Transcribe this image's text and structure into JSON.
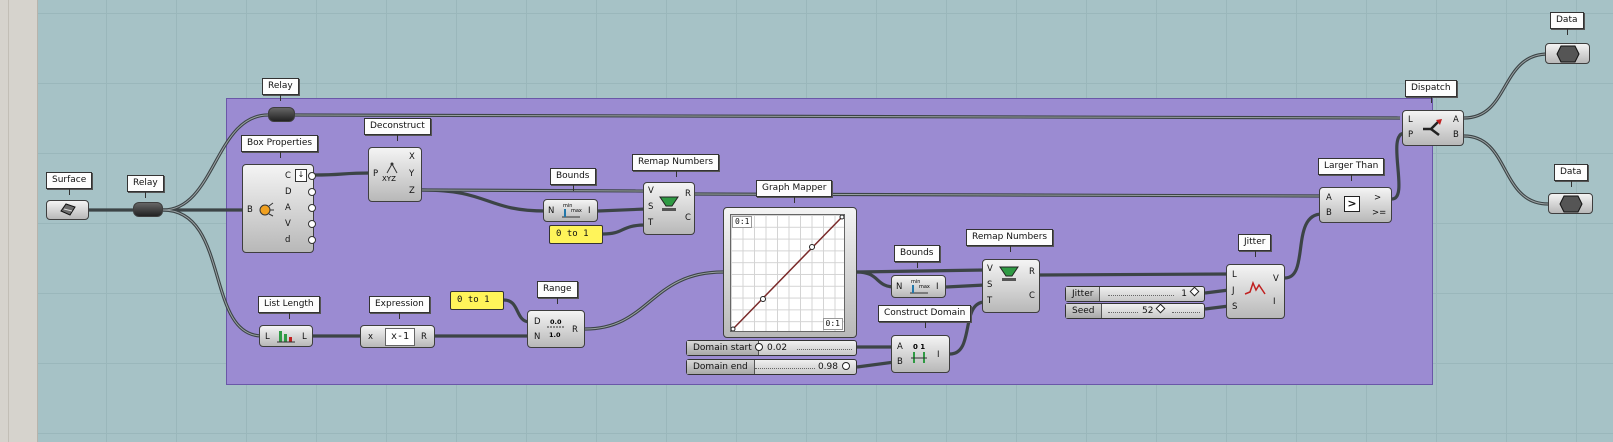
{
  "canvas": {
    "background": "#a6c2c6",
    "group_color": "#9b8bd2"
  },
  "labels": {
    "surface": "Surface",
    "relay_left": "Relay",
    "relay_top": "Relay",
    "box_properties": "Box Properties",
    "deconstruct": "Deconstruct",
    "bounds_1": "Bounds",
    "remap_1": "Remap Numbers",
    "graph_mapper": "Graph Mapper",
    "list_length": "List Length",
    "expression": "Expression",
    "range": "Range",
    "bounds_2": "Bounds",
    "remap_2": "Remap Numbers",
    "construct_domain": "Construct Domain",
    "jitter": "Jitter",
    "larger_than": "Larger Than",
    "dispatch": "Dispatch",
    "data_top": "Data",
    "data_bottom": "Data"
  },
  "ports": {
    "box_in": [
      "B"
    ],
    "box_out": [
      "C",
      "D",
      "A",
      "V",
      "d"
    ],
    "deconstruct_in": [
      "P"
    ],
    "deconstruct_out": [
      "X",
      "Y",
      "Z"
    ],
    "bounds_in": [
      "N"
    ],
    "bounds_out": [
      "I"
    ],
    "remap_in": [
      "V",
      "S",
      "T"
    ],
    "remap_out": [
      "R",
      "C"
    ],
    "list_in": [
      "L"
    ],
    "list_out": [
      "L"
    ],
    "expr_in": [
      "x"
    ],
    "expr_out": [
      "R"
    ],
    "range_in": [
      "D",
      "N"
    ],
    "range_out": [
      "R"
    ],
    "construct_in": [
      "A",
      "B"
    ],
    "construct_out": [
      "I"
    ],
    "jitter_in": [
      "L",
      "J",
      "S"
    ],
    "jitter_out": [
      "V",
      "I"
    ],
    "larger_in": [
      "A",
      "B"
    ],
    "larger_out": [
      ">",
      ">="
    ],
    "dispatch_in": [
      "L",
      "P"
    ],
    "dispatch_out": [
      "A",
      "B"
    ]
  },
  "expression": {
    "text": "x-1"
  },
  "panels": {
    "domain_1": "0 to 1",
    "domain_2": "0 to 1"
  },
  "graph_mapper": {
    "tag_top": "0:1",
    "tag_bottom": "0:1"
  },
  "sliders": {
    "domain_start": {
      "name": "Domain start",
      "value": "0.02"
    },
    "domain_end": {
      "name": "Domain end",
      "value": "0.98"
    },
    "jitter": {
      "name": "Jitter",
      "value": "1"
    },
    "seed": {
      "name": "Seed",
      "value": "52"
    }
  },
  "icons": {
    "surface": "surface-icon",
    "box": "box-properties-icon",
    "deconstruct": "xyz-deconstruct-icon",
    "bounds": "bounds-icon",
    "remap": "remap-icon",
    "list": "list-length-icon",
    "range": "range-icon",
    "construct": "construct-domain-icon",
    "jitter": "jitter-icon",
    "larger": "larger-than-icon",
    "dispatch": "dispatch-icon",
    "data": "data-hexagon-icon"
  }
}
